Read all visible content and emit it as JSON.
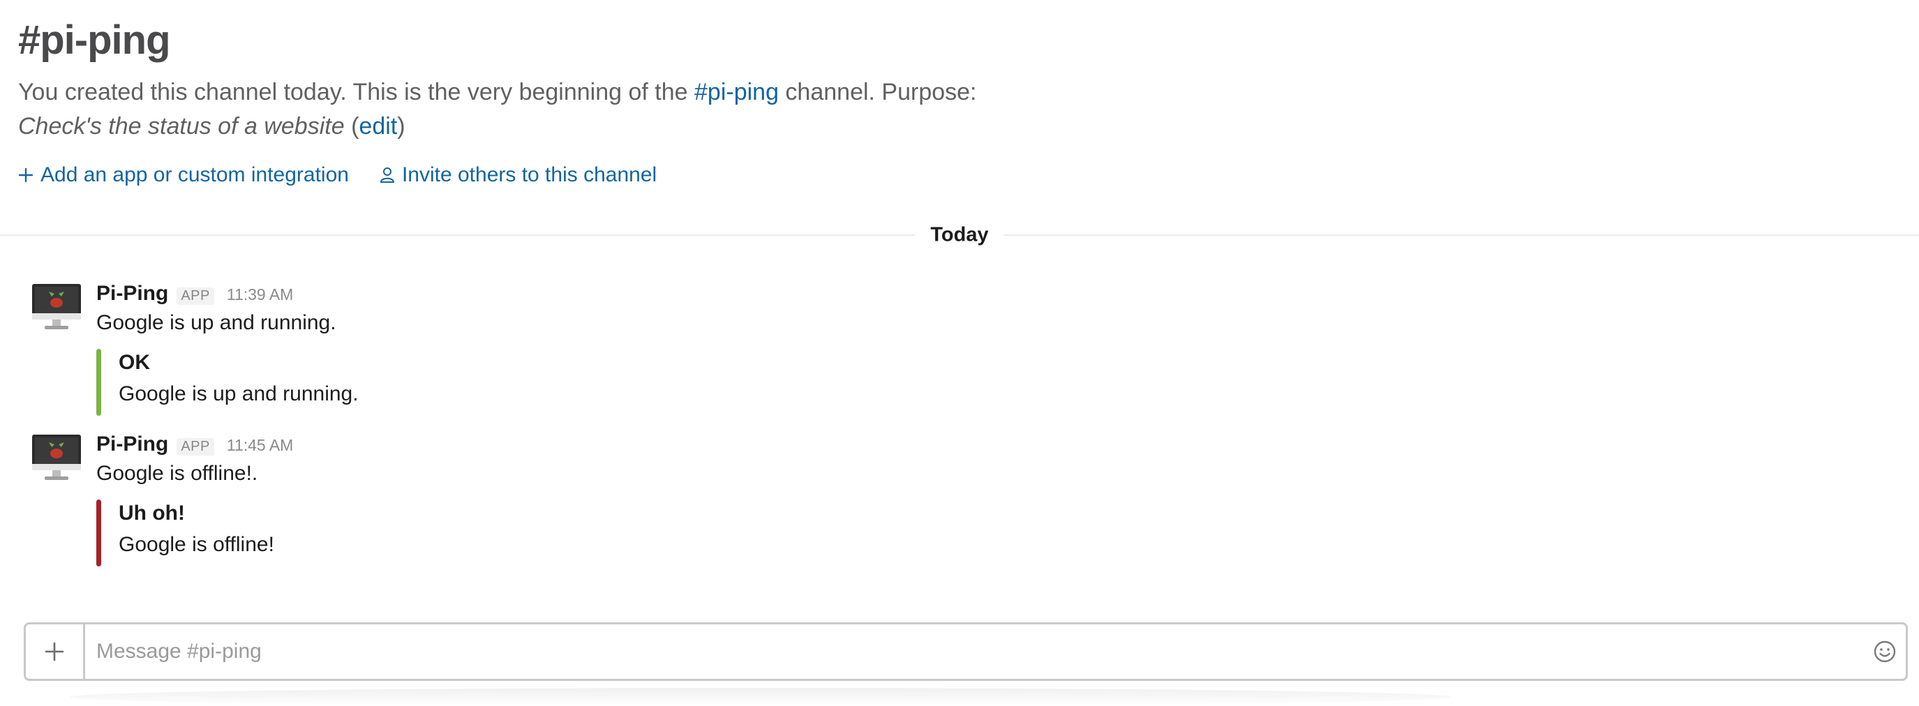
{
  "channel": {
    "title": "#pi-ping",
    "intro_prefix": "You created this channel today. This is the very beginning of the ",
    "intro_link": "#pi-ping",
    "intro_suffix": " channel. Purpose:",
    "purpose": "Check's the status of a website",
    "edit_open": " (",
    "edit_label": "edit",
    "edit_close": ")"
  },
  "actions": {
    "add_app": "Add an app or custom integration",
    "invite": "Invite others to this channel"
  },
  "day_divider": "Today",
  "messages": [
    {
      "sender": "Pi-Ping",
      "badge": "APP",
      "time": "11:39 AM",
      "text": "Google is up and running.",
      "attachment": {
        "title": "OK",
        "text": "Google is up and running.",
        "color": "#7cb342"
      }
    },
    {
      "sender": "Pi-Ping",
      "badge": "APP",
      "time": "11:45 AM",
      "text": "Google is offline!.",
      "attachment": {
        "title": "Uh oh!",
        "text": "Google is offline!",
        "color": "#a6222a"
      }
    }
  ],
  "composer": {
    "placeholder": "Message #pi-ping"
  },
  "icons": {
    "plus": "plus-icon",
    "person": "person-icon",
    "emoji": "smiley-icon",
    "avatar": "computer-monitor-icon"
  },
  "colors": {
    "link": "#1264a3",
    "ok": "#7cb342",
    "error": "#a6222a"
  }
}
